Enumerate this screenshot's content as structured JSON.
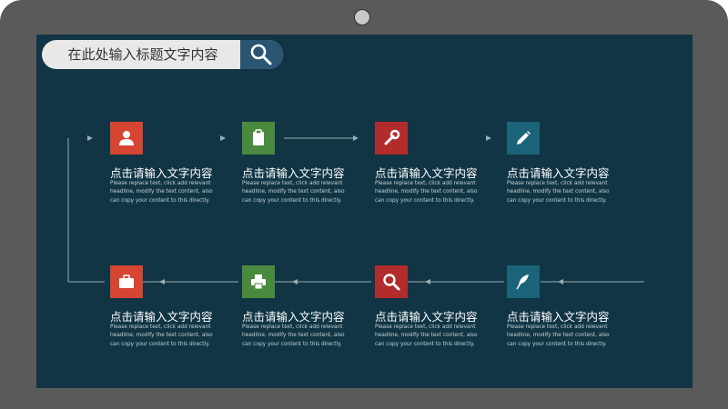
{
  "search": {
    "placeholder_text": "在此处输入标题文字内容",
    "icon": "search-icon"
  },
  "steps": [
    {
      "title": "点击请输入文字内容",
      "desc": "Please replace text, click add relevant headline, modify the text content, also can copy your content to this directly.",
      "icon": "user-icon",
      "color": "#d64532"
    },
    {
      "title": "点击请输入文字内容",
      "desc": "Please replace text, click add relevant headline, modify the text content, also can copy your content to this directly.",
      "icon": "clipboard-icon",
      "color": "#4a8a3e"
    },
    {
      "title": "点击请输入文字内容",
      "desc": "Please replace text, click add relevant headline, modify the text content, also can copy your content to this directly.",
      "icon": "wrench-icon",
      "color": "#b22c2c"
    },
    {
      "title": "点击请输入文字内容",
      "desc": "Please replace text, click add relevant headline, modify the text content, also can copy your content to this directly.",
      "icon": "pencil-icon",
      "color": "#1a6378"
    },
    {
      "title": "点击请输入文字内容",
      "desc": "Please replace text, click add relevant headline, modify the text content, also can copy your content to this directly.",
      "icon": "briefcase-icon",
      "color": "#d64532"
    },
    {
      "title": "点击请输入文字内容",
      "desc": "Please replace text, click add relevant headline, modify the text content, also can copy your content to this directly.",
      "icon": "printer-icon",
      "color": "#4a8a3e"
    },
    {
      "title": "点击请输入文字内容",
      "desc": "Please replace text, click add relevant headline, modify the text content, also can copy your content to this directly.",
      "icon": "search-icon",
      "color": "#b22c2c"
    },
    {
      "title": "点击请输入文字内容",
      "desc": "Please replace text, click add relevant headline, modify the text content, also can copy your content to this directly.",
      "icon": "quill-icon",
      "color": "#1a6378"
    }
  ]
}
